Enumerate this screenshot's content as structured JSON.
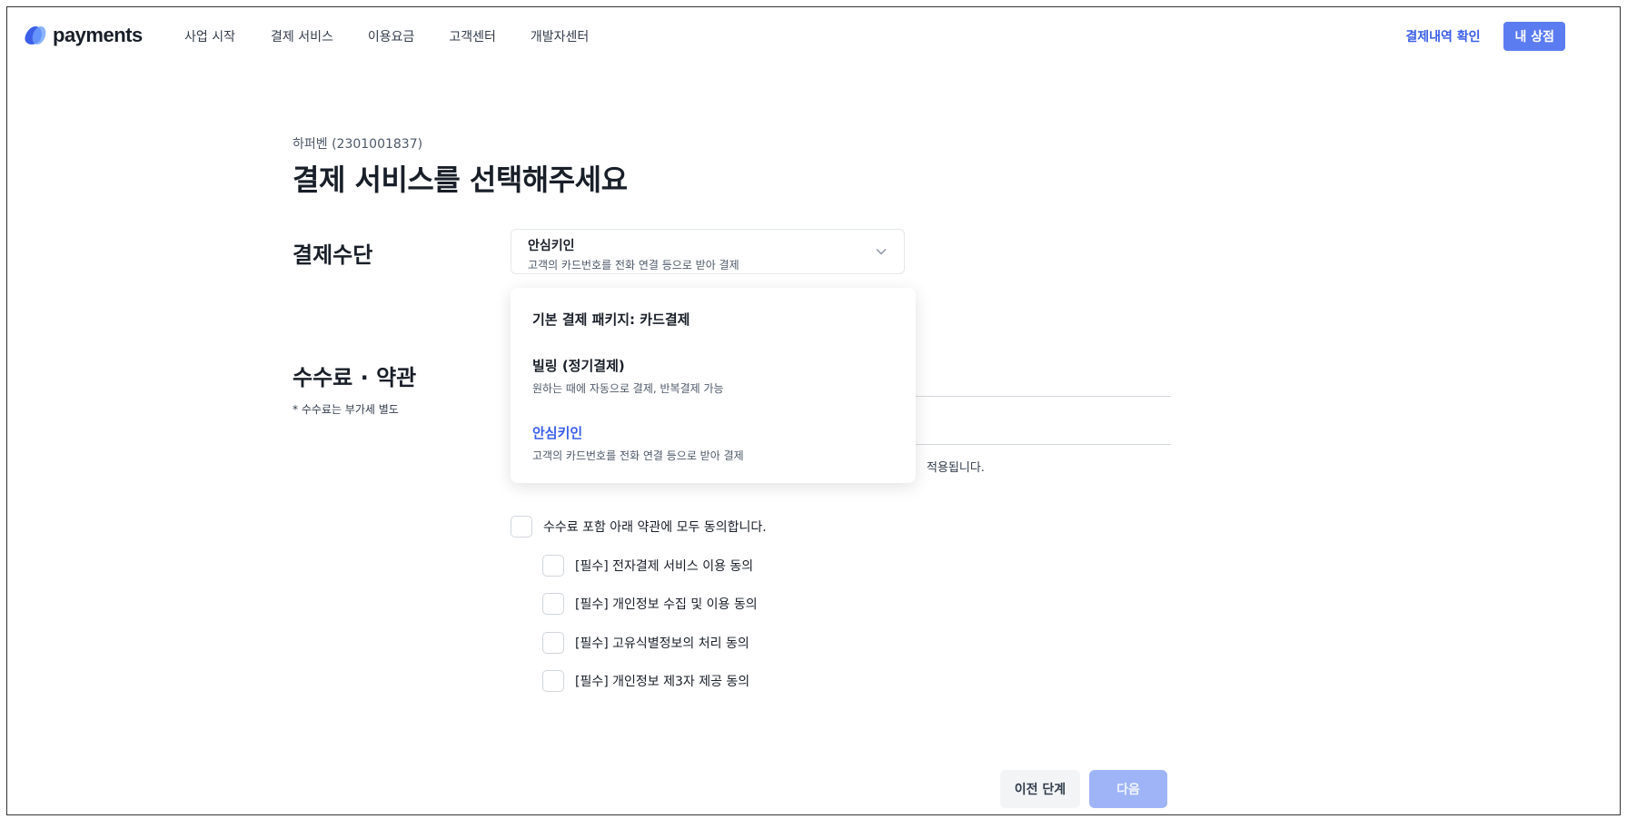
{
  "header": {
    "logo_text": "payments",
    "nav": [
      "사업 시작",
      "결제 서비스",
      "이용요금",
      "고객센터",
      "개발자센터"
    ],
    "payment_history_link": "결제내역 확인",
    "my_store_button": "내 상점"
  },
  "merchant": "하퍼벤 (2301001837)",
  "page_title": "결제 서비스를 선택해주세요",
  "payment_method": {
    "label": "결제수단",
    "selected_title": "안심키인",
    "selected_desc": "고객의 카드번호를 전화 연결 등으로 받아 결제"
  },
  "dropdown": {
    "items": [
      {
        "title": "기본 결제 패키지: 카드결제",
        "desc": ""
      },
      {
        "title": "빌링 (정기결제)",
        "desc": "원하는 때에 자동으로 결제, 반복결제 가능"
      },
      {
        "title": "안심키인",
        "desc": "고객의 카드번호를 전화 연결 등으로 받아 결제"
      }
    ]
  },
  "fees": {
    "label": "수수료 · 약관",
    "note": "* 수수료는 부가세 별도",
    "partial_text": "적용됩니다."
  },
  "agreements": {
    "all": "수수료 포함 아래 약관에 모두 동의합니다.",
    "items": [
      "[필수] 전자결제 서비스 이용 동의",
      "[필수] 개인정보 수집 및 이용 동의",
      "[필수] 고유식별정보의 처리 동의",
      "[필수] 개인정보 제3자 제공 동의"
    ]
  },
  "buttons": {
    "prev": "이전 단계",
    "next": "다음"
  },
  "colors": {
    "accent": "#3b5ee8",
    "button_primary": "#5b7cf0",
    "next_disabled": "#9fb4f7"
  }
}
